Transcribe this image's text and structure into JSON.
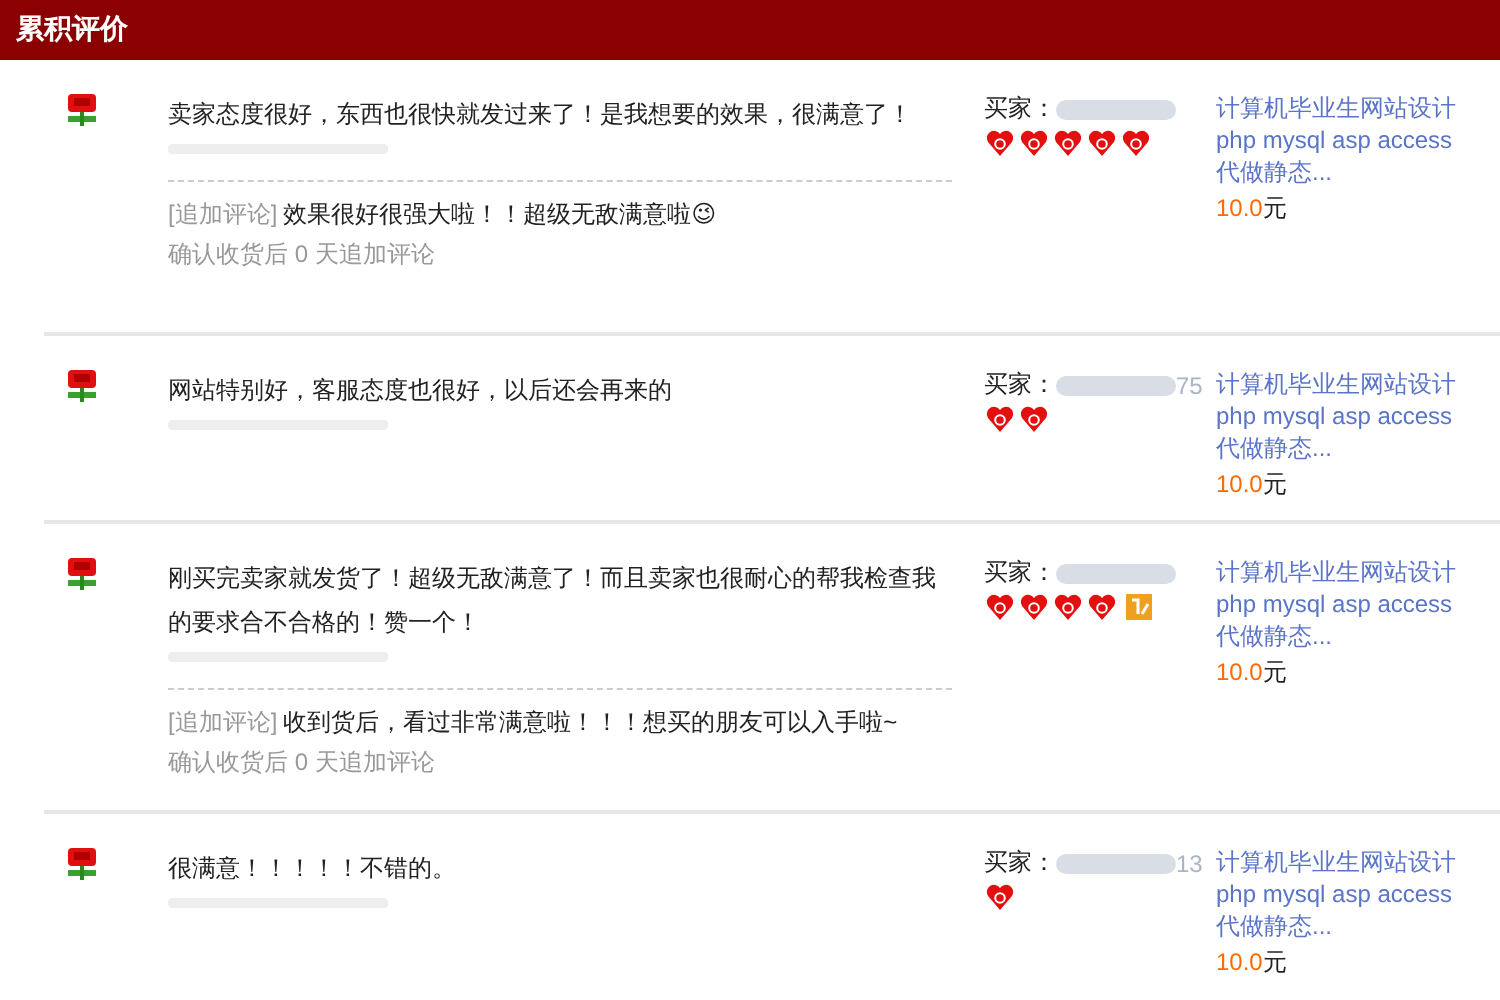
{
  "header": {
    "title": "累积评价"
  },
  "reviews": [
    {
      "comment": "卖家态度很好，东西也很快就发过来了！是我想要的效果，很满意了！",
      "followup": {
        "label": "[追加评论]",
        "text": "效果很好很强大啦！！超级无敌满意啦😉",
        "note": "确认收货后 0 天追加评论"
      },
      "buyer_label": "买家：",
      "credit_icons": [
        {
          "kind": "heart"
        },
        {
          "kind": "heart"
        },
        {
          "kind": "heart"
        },
        {
          "kind": "heart"
        },
        {
          "kind": "heart"
        }
      ],
      "product": "计算机毕业生网站设计php mysql asp access代做静态...",
      "price": "10.0",
      "currency": "元"
    },
    {
      "comment": "网站特别好，客服态度也很好，以后还会再来的",
      "buyer_label": "买家：",
      "buyer_suffix": "75",
      "credit_icons": [
        {
          "kind": "heart"
        },
        {
          "kind": "heart"
        }
      ],
      "product": "计算机毕业生网站设计php mysql asp access代做静态...",
      "price": "10.0",
      "currency": "元"
    },
    {
      "comment": "刚买完卖家就发货了！超级无敌满意了！而且卖家也很耐心的帮我检查我的要求合不合格的！赞一个！",
      "followup": {
        "label": "[追加评论]",
        "text": "收到货后，看过非常满意啦！！！想买的朋友可以入手啦~",
        "note": "确认收货后 0 天追加评论"
      },
      "buyer_label": "买家：",
      "credit_icons": [
        {
          "kind": "heart"
        },
        {
          "kind": "heart"
        },
        {
          "kind": "heart"
        },
        {
          "kind": "heart"
        },
        {
          "kind": "badge"
        }
      ],
      "product": "计算机毕业生网站设计php mysql asp access代做静态...",
      "price": "10.0",
      "currency": "元"
    },
    {
      "comment": "很满意！！！！！不错的。",
      "buyer_label": "买家：",
      "buyer_suffix": "13",
      "credit_icons": [
        {
          "kind": "heart"
        }
      ],
      "product": "计算机毕业生网站设计php mysql asp access代做静态...",
      "price": "10.0",
      "currency": "元"
    }
  ]
}
